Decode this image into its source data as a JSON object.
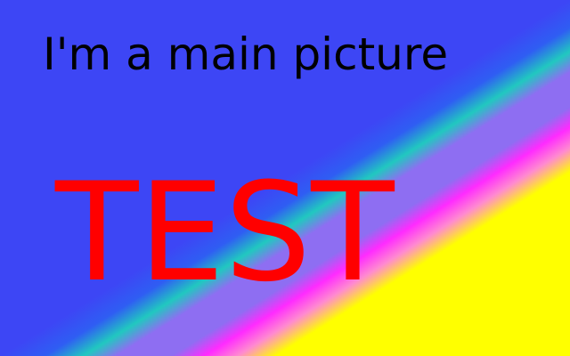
{
  "picture": {
    "caption": "I'm a main picture",
    "label": "TEST"
  },
  "colors": {
    "background_blue": "#3d46f5",
    "band_cyan": "#21c8c0",
    "band_violet": "#8e6ef2",
    "band_magenta": "#ff2bff",
    "band_pink": "#ff8ad0",
    "background_yellow": "#ffff00",
    "caption_text": "#000000",
    "label_text": "#ff0000"
  }
}
